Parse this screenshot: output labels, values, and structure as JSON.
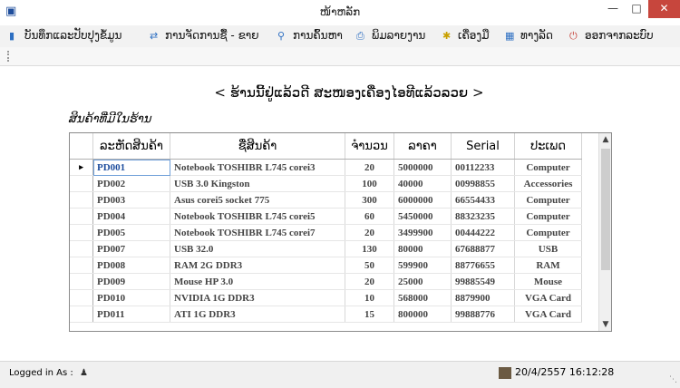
{
  "window": {
    "title": "ໜ້າຫລັກ"
  },
  "menu": [
    {
      "label": "ບັນທຶກແລະປັບປຸງຂໍ້ມູນ",
      "icon": "book-icon"
    },
    {
      "label": "ການຈັດການຊື້ - ຂາຍ",
      "icon": "exchange-icon"
    },
    {
      "label": "ການຄົ້ນຫາ",
      "icon": "search-person-icon"
    },
    {
      "label": "ພິມລາຍງານ",
      "icon": "printer-icon"
    },
    {
      "label": "ເຄື່ອງມື",
      "icon": "tools-icon"
    },
    {
      "label": "ທາງລັດ",
      "icon": "shortcut-icon"
    },
    {
      "label": "ອອກຈາກລະບົບ",
      "icon": "power-icon"
    }
  ],
  "heading": "< ຮ້ານນີ້ຢູ່ແລ້ວດີ ສະໜອງເຄື່ອງໄອທີແລ້ວລວຍ >",
  "subheading": "ສິນຄ້າທີ່ມີໃນຮ້ານ",
  "table": {
    "headers": [
      "ລະຫັດສິນຄ້າ",
      "ຊື່ສິນຄ້າ",
      "ຈຳນວນ",
      "ລາຄາ",
      "Serial",
      "ປະເພດ"
    ],
    "rows": [
      [
        "PD001",
        "Notebook TOSHIBR L745 corei3",
        "20",
        "5000000",
        "00112233",
        "Computer"
      ],
      [
        "PD002",
        "USB 3.0 Kingston",
        "100",
        "40000",
        "00998855",
        "Accessories"
      ],
      [
        "PD003",
        "Asus corei5 socket 775",
        "300",
        "6000000",
        "66554433",
        "Computer"
      ],
      [
        "PD004",
        "Notebook TOSHIBR L745 corei5",
        "60",
        "5450000",
        "88323235",
        "Computer"
      ],
      [
        "PD005",
        "Notebook TOSHIBR L745 corei7",
        "20",
        "3499900",
        "00444222",
        "Computer"
      ],
      [
        "PD007",
        "USB 32.0",
        "130",
        "80000",
        "67688877",
        "USB"
      ],
      [
        "PD008",
        "RAM 2G DDR3",
        "50",
        "599900",
        "88776655",
        "RAM"
      ],
      [
        "PD009",
        "Mouse HP 3.0",
        "20",
        "25000",
        "99885549",
        "Mouse"
      ],
      [
        "PD010",
        "NVIDIA 1G DDR3",
        "10",
        "568000",
        "8879900",
        "VGA Card"
      ],
      [
        "PD011",
        "ATI 1G DDR3",
        "15",
        "800000",
        "99888776",
        "VGA Card"
      ]
    ],
    "selected_row": 0,
    "row_marker": "▸"
  },
  "status": {
    "logged_in_label": "Logged in As :",
    "datetime": "20/4/2557 16:12:28"
  },
  "colors": {
    "close_button": "#c7463d",
    "selection_border": "#6f9fd8"
  }
}
